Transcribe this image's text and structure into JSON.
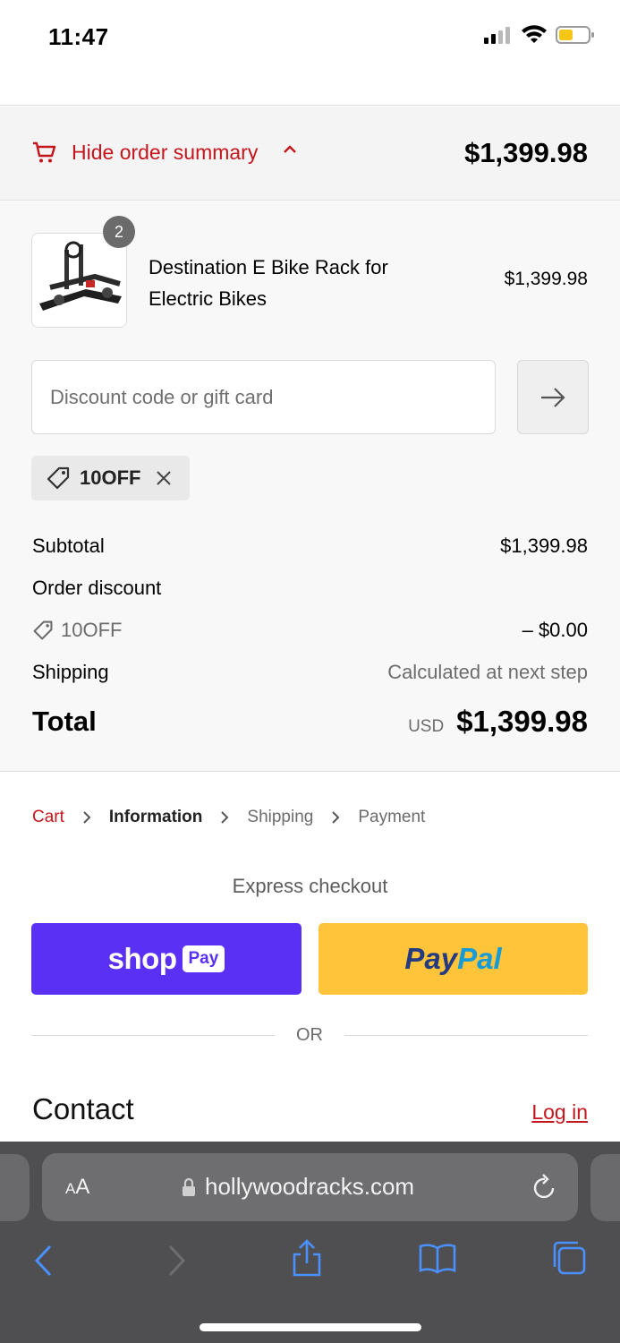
{
  "status": {
    "time": "11:47"
  },
  "summary_toggle": {
    "label": "Hide order summary",
    "total": "$1,399.98"
  },
  "product": {
    "quantity": "2",
    "name": "Destination E Bike Rack for Electric Bikes",
    "price": "$1,399.98"
  },
  "discount": {
    "placeholder": "Discount code or gift card",
    "applied_code": "10OFF"
  },
  "totals": {
    "subtotal_label": "Subtotal",
    "subtotal_value": "$1,399.98",
    "order_discount_label": "Order discount",
    "discount_code": "10OFF",
    "discount_value": "– $0.00",
    "shipping_label": "Shipping",
    "shipping_value": "Calculated at next step",
    "total_label": "Total",
    "currency": "USD",
    "total_value": "$1,399.98"
  },
  "breadcrumb": {
    "cart": "Cart",
    "information": "Information",
    "shipping": "Shipping",
    "payment": "Payment"
  },
  "express": {
    "title": "Express checkout",
    "shop_word": "shop",
    "shop_pay_box": "Pay",
    "paypal_1": "Pay",
    "paypal_2": "Pal",
    "or_text": "OR"
  },
  "contact": {
    "title": "Contact",
    "login": "Log in"
  },
  "browser": {
    "aa_big": "A",
    "aa_small": "A",
    "url": "hollywoodracks.com"
  },
  "colors": {
    "accent_red": "#c4161c",
    "shop_pay_purple": "#5a31f4",
    "paypal_yellow": "#ffc439",
    "safari_blue": "#4a90ff"
  }
}
